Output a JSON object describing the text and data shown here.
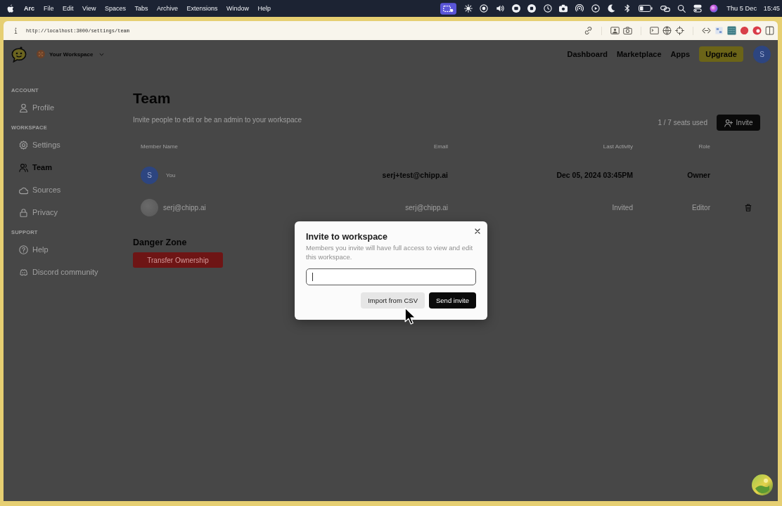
{
  "menu_bar": {
    "app_name": "Arc",
    "menus": [
      "File",
      "Edit",
      "View",
      "Spaces",
      "Tabs",
      "Archive",
      "Extensions",
      "Window",
      "Help"
    ],
    "date": "Thu 5 Dec",
    "time": "15:45"
  },
  "browser": {
    "url": "http://localhost:3000/settings/team"
  },
  "header": {
    "workspace": "Your Workspace",
    "nav": [
      {
        "label": "Dashboard"
      },
      {
        "label": "Marketplace"
      },
      {
        "label": "Apps"
      }
    ],
    "upgrade_button": "Upgrade",
    "avatar": "S"
  },
  "sidebar": {
    "sections": [
      {
        "title": "ACCOUNT",
        "items": [
          {
            "label": "Profile",
            "selected": false
          }
        ]
      },
      {
        "title": "WORKSPACE",
        "items": [
          {
            "label": "Settings",
            "selected": false
          },
          {
            "label": "Team",
            "selected": true
          },
          {
            "label": "Sources",
            "selected": false
          },
          {
            "label": "Privacy",
            "selected": false
          }
        ]
      },
      {
        "title": "SUPPORT",
        "items": [
          {
            "label": "Help",
            "selected": false
          },
          {
            "label": "Discord community",
            "selected": false
          }
        ]
      }
    ]
  },
  "team": {
    "title": "Team",
    "description": "Invite people to edit or be an admin to your workspace",
    "seats": "1 / 7 seats used",
    "invite_button": "Invite",
    "columns": [
      "Member Name",
      "Email",
      "Last Activity",
      "Role"
    ],
    "members": [
      {
        "avatar": {
          "kind": "letter",
          "text": "S"
        },
        "tag": "You",
        "email": "serj+test@chipp.ai",
        "last_activity": "Dec 05, 2024 03:45PM",
        "role": "Owner",
        "pending": false,
        "removable": false
      },
      {
        "avatar": {
          "kind": "photo"
        },
        "name": "serj@chipp.ai",
        "email": "serj@chipp.ai",
        "last_activity": "Invited",
        "role": "Editor",
        "pending": true,
        "removable": true
      }
    ]
  },
  "danger_zone": {
    "title": "Danger Zone",
    "button": "Transfer Ownership"
  },
  "modal": {
    "title": "Invite to workspace",
    "description": "Members you invite will have full access to view and edit this workspace.",
    "input": {
      "focused": true
    },
    "buttons": [
      {
        "label": "Import from CSV",
        "kind": "secondary"
      },
      {
        "label": "Send invite",
        "kind": "primary"
      }
    ]
  }
}
